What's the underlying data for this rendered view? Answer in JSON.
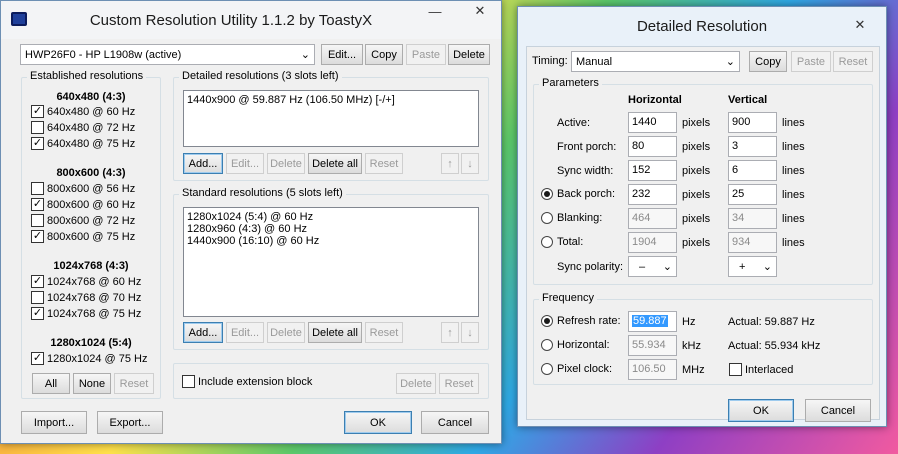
{
  "cru": {
    "title": "Custom Resolution Utility 1.1.2 by ToastyX",
    "monitor": "HWP26F0 - HP L1908w (active)",
    "top_buttons": {
      "edit": "Edit...",
      "copy": "Copy",
      "paste": "Paste",
      "delete": "Delete"
    },
    "established": {
      "label": "Established resolutions",
      "groups": [
        {
          "title": "640x480 (4:3)",
          "items": [
            {
              "label": "640x480 @ 60 Hz",
              "checked": true
            },
            {
              "label": "640x480 @ 72 Hz",
              "checked": false
            },
            {
              "label": "640x480 @ 75 Hz",
              "checked": true
            }
          ]
        },
        {
          "title": "800x600 (4:3)",
          "items": [
            {
              "label": "800x600 @ 56 Hz",
              "checked": false
            },
            {
              "label": "800x600 @ 60 Hz",
              "checked": true
            },
            {
              "label": "800x600 @ 72 Hz",
              "checked": false
            },
            {
              "label": "800x600 @ 75 Hz",
              "checked": true
            }
          ]
        },
        {
          "title": "1024x768 (4:3)",
          "items": [
            {
              "label": "1024x768 @ 60 Hz",
              "checked": true
            },
            {
              "label": "1024x768 @ 70 Hz",
              "checked": false
            },
            {
              "label": "1024x768 @ 75 Hz",
              "checked": true
            }
          ]
        },
        {
          "title": "1280x1024 (5:4)",
          "items": [
            {
              "label": "1280x1024 @ 75 Hz",
              "checked": true
            }
          ]
        }
      ],
      "all": "All",
      "none": "None",
      "reset": "Reset"
    },
    "detailed": {
      "label": "Detailed resolutions (3 slots left)",
      "items": [
        "1440x900 @ 59.887 Hz (106.50 MHz) [-/+]"
      ],
      "add": "Add...",
      "edit": "Edit...",
      "delete": "Delete",
      "delete_all": "Delete all",
      "reset": "Reset"
    },
    "standard": {
      "label": "Standard resolutions (5 slots left)",
      "items": [
        "1280x1024 (5:4) @ 60 Hz",
        "1280x960 (4:3) @ 60 Hz",
        "1440x900 (16:10) @ 60 Hz"
      ],
      "add": "Add...",
      "edit": "Edit...",
      "delete": "Delete",
      "delete_all": "Delete all",
      "reset": "Reset"
    },
    "extension": {
      "label": "Include extension block",
      "delete": "Delete",
      "reset": "Reset"
    },
    "import": "Import...",
    "export": "Export...",
    "ok": "OK",
    "cancel": "Cancel"
  },
  "dr": {
    "title": "Detailed Resolution",
    "timing_label": "Timing:",
    "timing_value": "Manual",
    "copy": "Copy",
    "paste": "Paste",
    "reset": "Reset",
    "parameters": "Parameters",
    "h_header": "Horizontal",
    "v_header": "Vertical",
    "rows": [
      {
        "label": "Active:",
        "h": "1440",
        "hunit": "pixels",
        "v": "900",
        "vunit": "lines",
        "radio": null,
        "ro": false
      },
      {
        "label": "Front porch:",
        "h": "80",
        "hunit": "pixels",
        "v": "3",
        "vunit": "lines",
        "radio": null,
        "ro": false
      },
      {
        "label": "Sync width:",
        "h": "152",
        "hunit": "pixels",
        "v": "6",
        "vunit": "lines",
        "radio": null,
        "ro": false
      },
      {
        "label": "Back porch:",
        "h": "232",
        "hunit": "pixels",
        "v": "25",
        "vunit": "lines",
        "radio": true,
        "ro": false
      },
      {
        "label": "Blanking:",
        "h": "464",
        "hunit": "pixels",
        "v": "34",
        "vunit": "lines",
        "radio": false,
        "ro": true
      },
      {
        "label": "Total:",
        "h": "1904",
        "hunit": "pixels",
        "v": "934",
        "vunit": "lines",
        "radio": false,
        "ro": true
      }
    ],
    "sync_polarity": "Sync polarity:",
    "h_pol": "–",
    "v_pol": "+",
    "frequency": "Frequency",
    "refresh_label": "Refresh rate:",
    "refresh_value": "59.887",
    "refresh_unit": "Hz",
    "refresh_actual": "Actual: 59.887 Hz",
    "horizontal_label": "Horizontal:",
    "horizontal_value": "55.934",
    "horizontal_unit": "kHz",
    "horizontal_actual": "Actual: 55.934 kHz",
    "pixel_label": "Pixel clock:",
    "pixel_value": "106.50",
    "pixel_unit": "MHz",
    "interlaced": "Interlaced",
    "ok": "OK",
    "cancel": "Cancel"
  }
}
